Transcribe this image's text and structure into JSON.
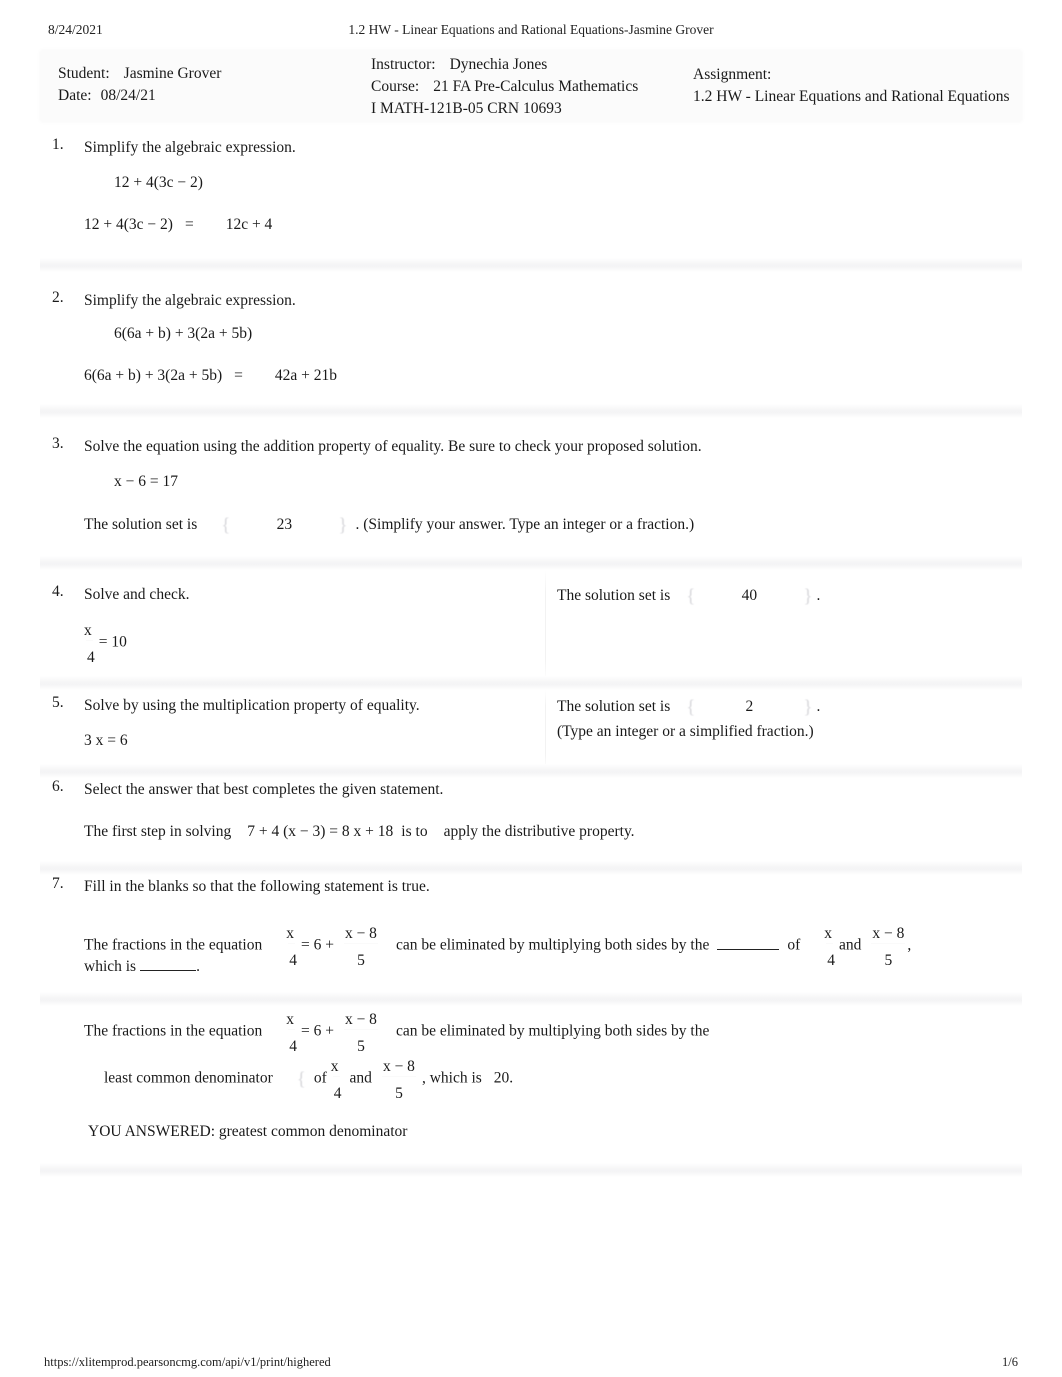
{
  "print": {
    "date": "8/24/2021",
    "title": "1.2 HW - Linear Equations and Rational Equations-Jasmine Grover",
    "footer_url": "https://xlitemprod.pearsoncmg.com/api/v1/print/highered",
    "page_label": "1/6"
  },
  "info": {
    "student_label": "Student:",
    "student_value": "Jasmine Grover",
    "date_label": "Date:",
    "date_value": "08/24/21",
    "instructor_label": "Instructor:",
    "instructor_value": "Dynechia Jones",
    "course_label": "Course:",
    "course_value_line1": "21 FA Pre-Calculus Mathematics",
    "course_value_line2": "I MATH-121B-05 CRN 10693",
    "assignment_label": "Assignment:",
    "assignment_value": "1.2 HW - Linear Equations and Rational Equations"
  },
  "questions": [
    {
      "number": "1.",
      "prompt": "Simplify the algebraic expression.",
      "given": "12 + 4(3c − 2)",
      "answer_lhs": "12 + 4(3c − 2)",
      "equals": "=",
      "answer": "12c + 4"
    },
    {
      "number": "2.",
      "prompt": "Simplify the algebraic expression.",
      "given": "6(6a + b) + 3(2a + 5b)",
      "answer_lhs": "6(6a + b) + 3(2a + 5b)",
      "equals": "=",
      "answer": "42a + 21b"
    },
    {
      "number": "3.",
      "prompt": "Solve the equation using the addition property of equality. Be sure to check your proposed solution.",
      "given": "x − 6 = 17",
      "answer_prefix": "The solution set is",
      "answer": "23",
      "answer_suffix": ". (Simplify your answer. Type an integer or a fraction.)",
      "brace_open": "{",
      "brace_close": "}"
    },
    {
      "number": "4.",
      "prompt": "Solve and check.",
      "frac_num": "x",
      "frac_den": "4",
      "frac_rhs": "= 10",
      "answer_prefix": "The solution set is",
      "answer": "40",
      "answer_suffix": ".",
      "brace_open": "{",
      "brace_close": "}"
    },
    {
      "number": "5.",
      "prompt": "Solve by using the multiplication property of equality.",
      "given": "3 x = 6",
      "answer_prefix": "The solution set is",
      "answer": "2",
      "answer_suffix": ".",
      "answer_note": "(Type an integer or a simplified fraction.)",
      "brace_open": "{",
      "brace_close": "}"
    },
    {
      "number": "6.",
      "prompt": "Select the answer that best completes the given statement.",
      "stem_a": "The first step in solving",
      "equation": "7 + 4 (x − 3) = 8 x + 18",
      "stem_b": "is to",
      "answer": "apply the distributive property."
    },
    {
      "number": "7.",
      "prompt": "Fill in the blanks so that the following statement is true.",
      "line1_a": "The fractions in the equation",
      "f1_num": "x",
      "f1_den": "4",
      "line1_mid": "= 6 +",
      "f2_num": "x − 8",
      "f2_den": "5",
      "line1_b": "can be eliminated by multiplying both sides by the",
      "line1_c": "of",
      "f3_num": "x",
      "f3_den": "4",
      "line1_and": "and",
      "f4_num": "x − 8",
      "f4_den": "5",
      "line1_comma": ",",
      "line2": "which is",
      "line2_end": ".",
      "sol_a": "The fractions in the equation",
      "sol_mid": "= 6 +",
      "sol_b": "can be eliminated by multiplying both sides by the",
      "sol_answer": "least common denominator",
      "sol_of": "of",
      "sol_and": "and",
      "sol_tail": ", which is",
      "sol_value": "20.",
      "you_answered": "YOU ANSWERED: greatest common denominator",
      "brace_open": "{"
    }
  ]
}
